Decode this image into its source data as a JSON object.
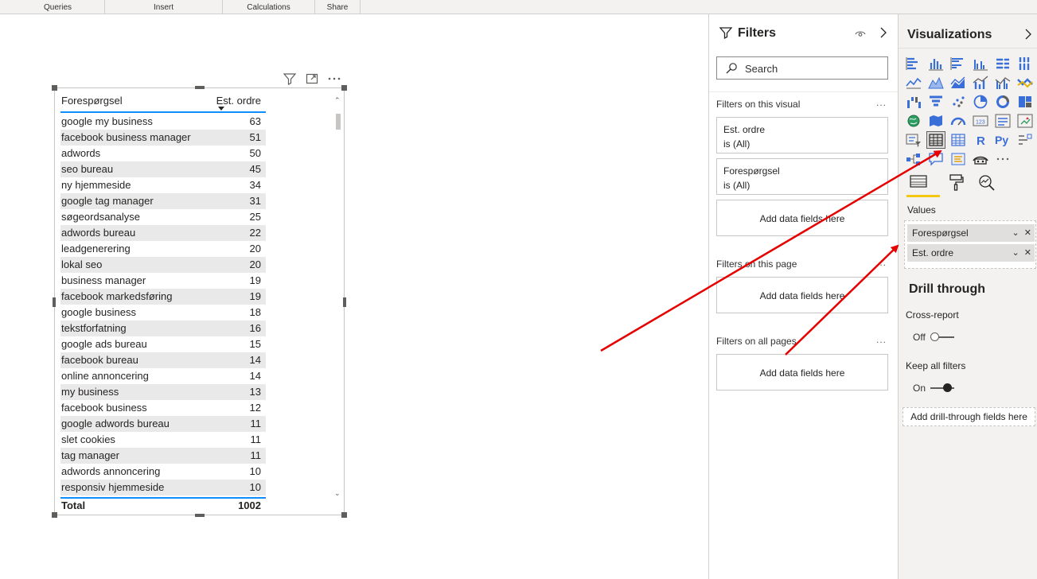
{
  "ribbon": {
    "groups": [
      "Queries",
      "Insert",
      "Calculations",
      "Share"
    ]
  },
  "table": {
    "col1": "Forespørgsel",
    "col2": "Est. ordre",
    "rows": [
      {
        "n": "google my business",
        "v": "63"
      },
      {
        "n": "facebook business manager",
        "v": "51"
      },
      {
        "n": "adwords",
        "v": "50"
      },
      {
        "n": "seo bureau",
        "v": "45"
      },
      {
        "n": "ny hjemmeside",
        "v": "34"
      },
      {
        "n": "google tag manager",
        "v": "31"
      },
      {
        "n": "søgeordsanalyse",
        "v": "25"
      },
      {
        "n": "adwords bureau",
        "v": "22"
      },
      {
        "n": "leadgenerering",
        "v": "20"
      },
      {
        "n": "lokal seo",
        "v": "20"
      },
      {
        "n": "business manager",
        "v": "19"
      },
      {
        "n": "facebook markedsføring",
        "v": "19"
      },
      {
        "n": "google business",
        "v": "18"
      },
      {
        "n": "tekstforfatning",
        "v": "16"
      },
      {
        "n": "google ads bureau",
        "v": "15"
      },
      {
        "n": "facebook bureau",
        "v": "14"
      },
      {
        "n": "online annoncering",
        "v": "14"
      },
      {
        "n": "my business",
        "v": "13"
      },
      {
        "n": "facebook business",
        "v": "12"
      },
      {
        "n": "google adwords bureau",
        "v": "11"
      },
      {
        "n": "slet cookies",
        "v": "11"
      },
      {
        "n": "tag manager",
        "v": "11"
      },
      {
        "n": "adwords annoncering",
        "v": "10"
      },
      {
        "n": "responsiv hjemmeside",
        "v": "10"
      }
    ],
    "total_label": "Total",
    "total_value": "1002"
  },
  "filters": {
    "title": "Filters",
    "search_placeholder": "Search",
    "on_visual": "Filters on this visual",
    "card1_title": "Est. ordre",
    "card1_state": "is (All)",
    "card2_title": "Forespørgsel",
    "card2_state": "is (All)",
    "add_fields": "Add data fields here",
    "on_page": "Filters on this page",
    "on_all": "Filters on all pages",
    "dots": "..."
  },
  "visualizations": {
    "title": "Visualizations",
    "values_label": "Values",
    "well1": "Forespørgsel",
    "well2": "Est. ordre",
    "drill_title": "Drill through",
    "cross_report": "Cross-report",
    "off_label": "Off",
    "keep_filters": "Keep all filters",
    "on_label": "On",
    "add_drill": "Add drill-through fields here",
    "accent": "#f2c811",
    "r_label": "R",
    "py_label": "Py"
  },
  "colors": {
    "accent_blue": "#118dff",
    "arrow_red": "#e60000"
  }
}
